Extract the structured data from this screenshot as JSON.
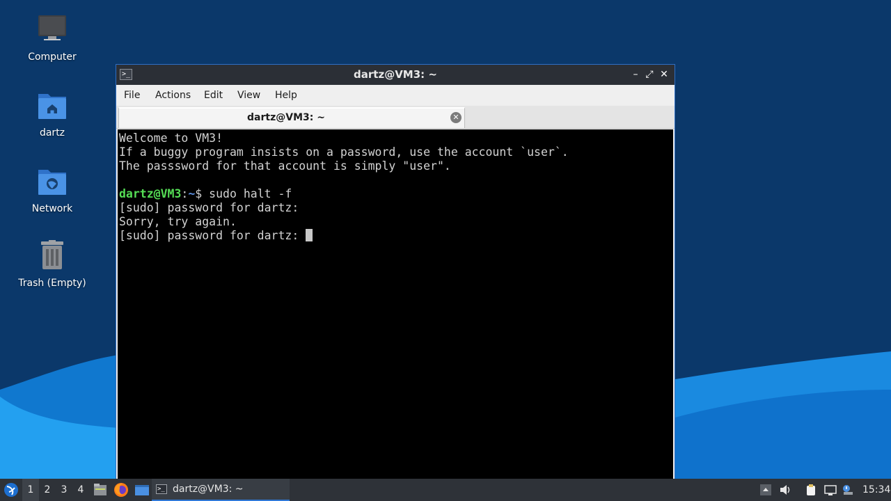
{
  "desktop": {
    "icons": [
      {
        "label": "Computer",
        "icon": "computer-icon"
      },
      {
        "label": "dartz",
        "icon": "home-folder-icon"
      },
      {
        "label": "Network",
        "icon": "network-folder-icon"
      },
      {
        "label": "Trash (Empty)",
        "icon": "trash-icon"
      }
    ]
  },
  "window": {
    "title": "dartz@VM3: ~",
    "controls": {
      "minimize": "–",
      "maximize": "⤢",
      "close": "✕"
    },
    "menu": [
      "File",
      "Actions",
      "Edit",
      "View",
      "Help"
    ],
    "tab": {
      "label": "dartz@VM3: ~",
      "close": "✕"
    }
  },
  "terminal": {
    "lines": [
      "Welcome to VM3!",
      "If a buggy program insists on a password, use the account `user`.",
      "The passsword for that account is simply \"user\"."
    ],
    "prompt": {
      "user_host": "dartz@VM3",
      "sep": ":",
      "path": "~",
      "symbol": "$"
    },
    "command": " sudo halt -f",
    "output": [
      "[sudo] password for dartz:",
      "Sorry, try again.",
      "[sudo] password for dartz: "
    ]
  },
  "taskbar": {
    "workspaces": [
      "1",
      "2",
      "3",
      "4"
    ],
    "active_workspace": "1",
    "task": {
      "label": "dartz@VM3: ~"
    },
    "clock": "15:34"
  },
  "colors": {
    "desktop_bg": "#0a3768",
    "wave": "#1592e6",
    "prompt_user": "#55dd55",
    "prompt_path": "#5b8fe0",
    "accent": "#2f78d6"
  }
}
